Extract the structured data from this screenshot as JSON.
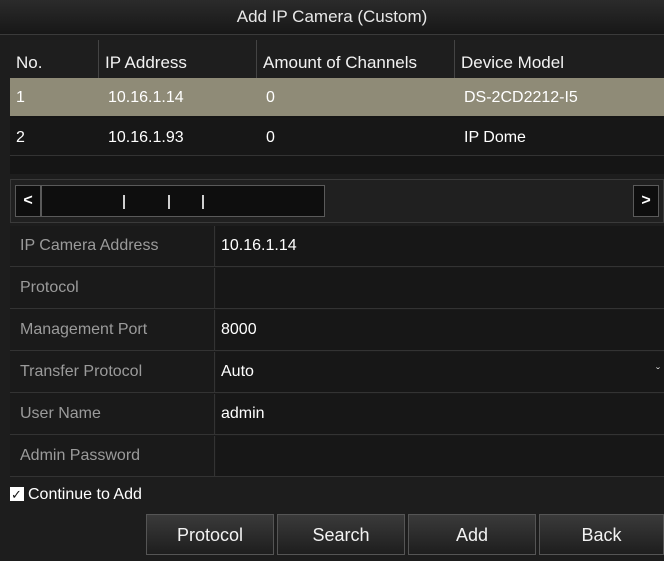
{
  "dialog": {
    "title": "Add IP Camera (Custom)"
  },
  "table": {
    "headers": [
      "No.",
      "IP Address",
      "Amount of Channels",
      "Device Model"
    ],
    "rows": [
      [
        "1",
        "10.16.1.14",
        "0",
        "DS-2CD2212-I5"
      ],
      [
        "2",
        "10.16.1.93",
        "0",
        "IP Dome"
      ]
    ],
    "selected_row": 0
  },
  "scrollbar": {
    "left_glyph": "<",
    "right_glyph": ">"
  },
  "form": {
    "ip_camera_address": {
      "label": "IP Camera Address",
      "value": "10.16.1.14"
    },
    "protocol": {
      "label": "Protocol",
      "value": ""
    },
    "management_port": {
      "label": "Management Port",
      "value": "8000"
    },
    "transfer_protocol": {
      "label": "Transfer Protocol",
      "value": "Auto",
      "arrow": "ˇ"
    },
    "user_name": {
      "label": "User Name",
      "value": "admin"
    },
    "admin_password": {
      "label": "Admin Password",
      "value": ""
    }
  },
  "continue_to_add": {
    "label": "Continue to Add",
    "checked": true,
    "check_glyph": "✓"
  },
  "buttons": {
    "protocol": "Protocol",
    "search": "Search",
    "add": "Add",
    "back": "Back"
  },
  "colors": {
    "selected_row": "#8f8b77",
    "background": "#1d1d1d"
  }
}
